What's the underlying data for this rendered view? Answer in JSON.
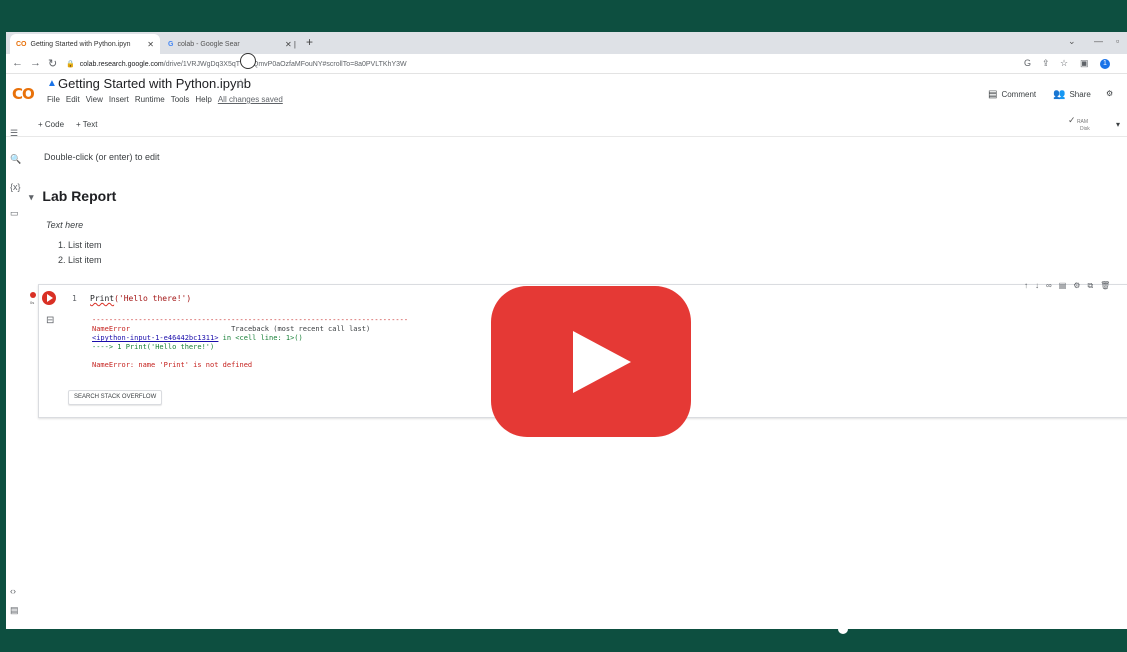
{
  "browser": {
    "tabs": [
      {
        "favicon": "CO",
        "label": "Getting Started with Python.ipyn"
      },
      {
        "favicon": "G",
        "label": "colab - Google Sear"
      }
    ],
    "new_tab": "+",
    "url_host": "colab.research.google.com",
    "url_path": "/drive/1VRJWgDq3X5qTVgFQmvP0aOzfaMFouNY#scrollTo=8a0PVLTKhY3W",
    "profile_initial": "1"
  },
  "colab": {
    "logo": "CO",
    "title": "Getting Started with Python.ipynb",
    "menu": [
      "File",
      "Edit",
      "View",
      "Insert",
      "Runtime",
      "Tools",
      "Help"
    ],
    "save_status": "All changes saved",
    "comment_label": "Comment",
    "share_label": "Share",
    "toolbar": {
      "code": "+ Code",
      "text": "+ Text",
      "ram": "RAM",
      "disk": "Disk"
    }
  },
  "notebook": {
    "hint": "Double-click (or enter) to edit",
    "section_title": "Lab Report",
    "paragraph": "Text here",
    "list": [
      "1. List item",
      "2. List item"
    ],
    "code_cell": {
      "line_number": "1",
      "code_fn": "Print",
      "code_args": "('Hello there!')",
      "output": {
        "rule": "---------------------------------------------------------------------------",
        "error_name": "NameError",
        "traceback_head": "Traceback (most recent call last)",
        "location_link": "<ipython-input-1-e46442bc1311>",
        "location_rest": " in <cell line: 1>()",
        "arrow_line": "----> 1 Print('Hello there!')",
        "error_msg": "NameError: name 'Print' is not defined"
      },
      "stack_overflow_button": "SEARCH STACK OVERFLOW"
    }
  },
  "colors": {
    "frame": "#0d4f40",
    "play": "#e53935",
    "colab_orange": "#e8710a",
    "error_red": "#d93025"
  }
}
